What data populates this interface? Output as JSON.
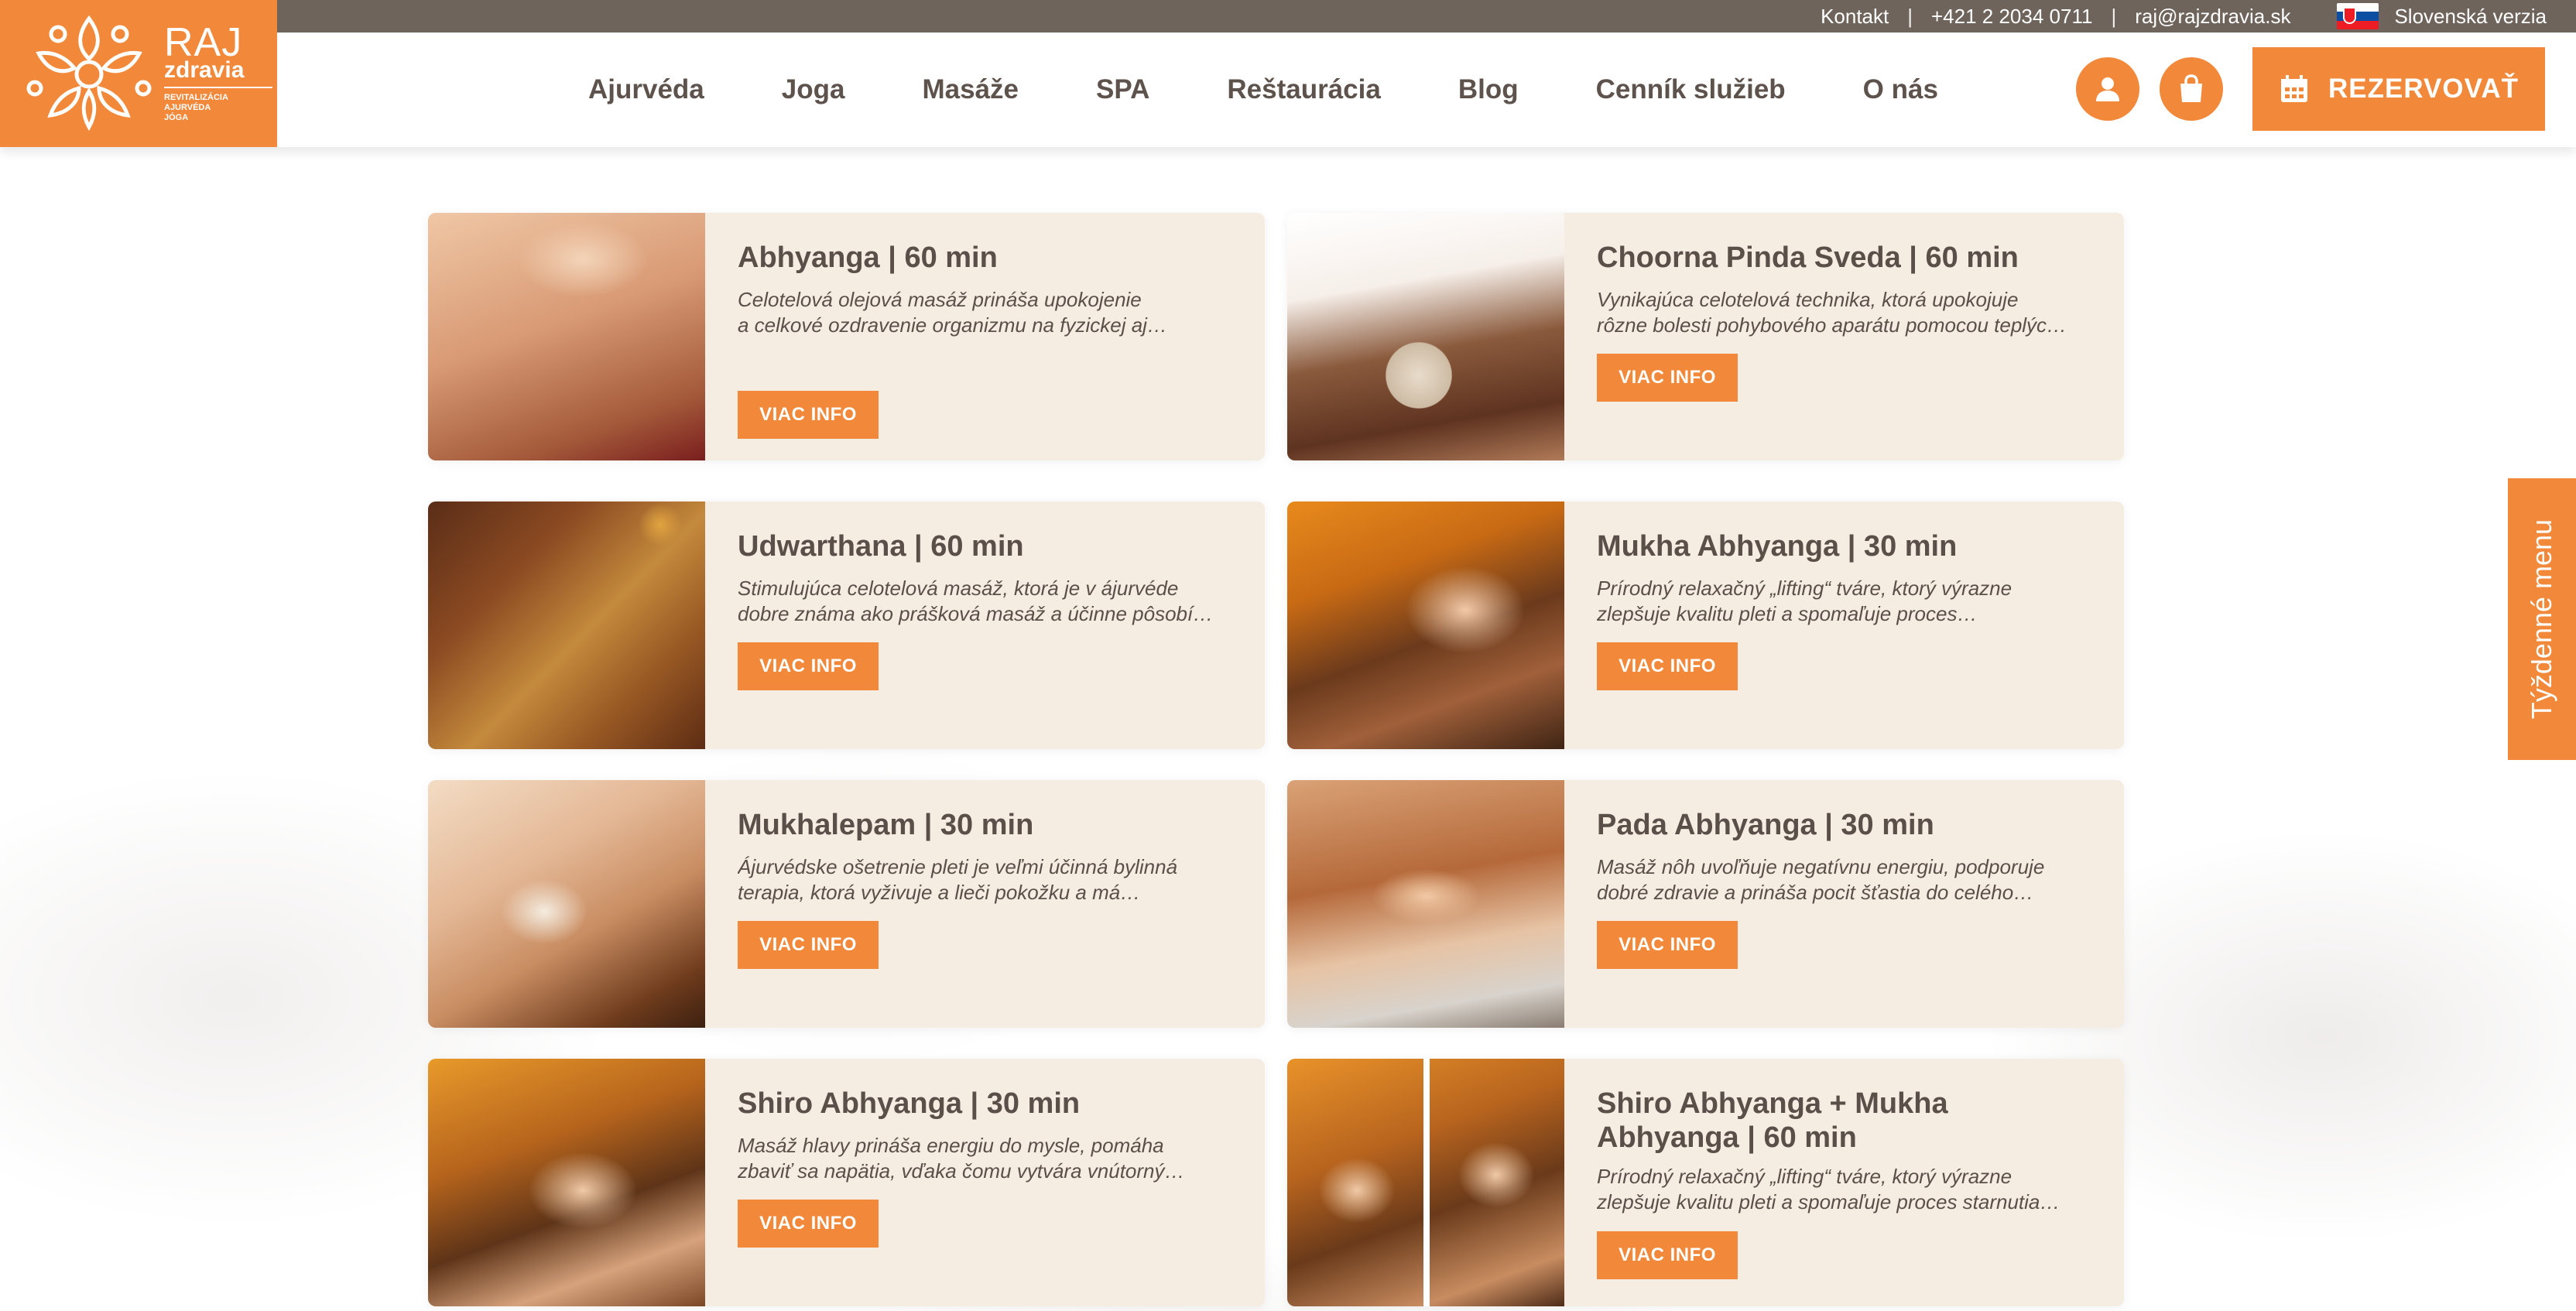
{
  "topbar": {
    "contact": "Kontakt",
    "phone": "+421 2 2034 0711",
    "email": "raj@rajzdravia.sk",
    "language": "Slovenská verzia"
  },
  "logo": {
    "title": "RAJ",
    "subtitle": "zdravia",
    "tagline": [
      "REVITALIZÁCIA",
      "AJURVÉDA",
      "JÓGA"
    ]
  },
  "nav": {
    "items": [
      "Ajurvéda",
      "Joga",
      "Masáže",
      "SPA",
      "Reštaurácia",
      "Blog",
      "Cenník služieb",
      "O nás"
    ]
  },
  "actions": {
    "user_icon": "user-icon",
    "bag_icon": "shopping-bag-icon",
    "reserve_label": "REZERVOVAŤ"
  },
  "side_tab": {
    "label": "Týždenné menu"
  },
  "colors": {
    "accent": "#f1883a",
    "topbar": "#6e645b",
    "card_bg": "#f5ece2",
    "text": "#5b5049"
  },
  "cards": [
    {
      "title": "Abhyanga | 60 min",
      "desc_line1": "Celotelová olejová masáž prináša upokojenie",
      "desc_line2": "a celkové ozdravenie organizmu na fyzickej aj…",
      "button": "VIAC INFO"
    },
    {
      "title": "Choorna Pinda Sveda | 60 min",
      "desc_line1": "Vynikajúca celotelová technika, ktorá upokojuje",
      "desc_line2": "rôzne bolesti pohybového aparátu pomocou teplýc…",
      "button": "VIAC INFO"
    },
    {
      "title": "Udwarthana | 60 min",
      "desc_line1": "Stimulujúca celotelová masáž, ktorá je v ájurvéde",
      "desc_line2": "dobre známa ako prášková masáž a účinne pôsobí…",
      "button": "VIAC INFO"
    },
    {
      "title": "Mukha Abhyanga | 30 min",
      "desc_line1": "Prírodný relaxačný „lifting“ tváre, ktorý výrazne",
      "desc_line2": "zlepšuje kvalitu pleti a spomaľuje proces…",
      "button": "VIAC INFO"
    },
    {
      "title": "Mukhalepam | 30 min",
      "desc_line1": "Ájurvédske ošetrenie pleti je veľmi účinná bylinná",
      "desc_line2": "terapia, ktorá vyživuje a lieči pokožku a má…",
      "button": "VIAC INFO"
    },
    {
      "title": "Pada Abhyanga | 30 min",
      "desc_line1": "Masáž nôh uvoľňuje negatívnu energiu, podporuje",
      "desc_line2": "dobré zdravie a prináša pocit šťastia do celého…",
      "button": "VIAC INFO"
    },
    {
      "title": "Shiro Abhyanga | 30 min",
      "desc_line1": "Masáž hlavy prináša energiu do mysle, pomáha",
      "desc_line2": "zbaviť sa napätia, vďaka čomu vytvára vnútorný…",
      "button": "VIAC INFO"
    },
    {
      "title_line1": "Shiro Abhyanga + Mukha",
      "title_line2": "Abhyanga | 60 min",
      "desc_line1": "Prírodný relaxačný „lifting“ tváre, ktorý výrazne",
      "desc_line2": "zlepšuje kvalitu pleti a spomaľuje proces starnutia…",
      "button": "VIAC INFO"
    }
  ]
}
